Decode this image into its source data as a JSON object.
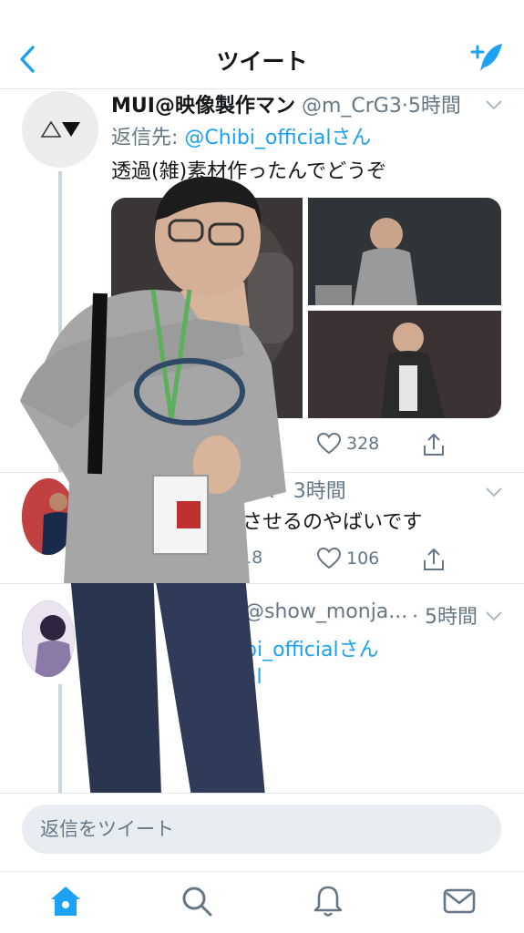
{
  "header": {
    "title": "ツイート"
  },
  "tweets": [
    {
      "name": "MUI@映像製作マン",
      "handle": "@m_CrG3",
      "time": "5時間",
      "reply_prefix": "返信先: ",
      "reply_to": "@Chibi_officialさん",
      "text": "透過(雑)素材作ったんでどうぞ",
      "likes": "328"
    },
    {
      "partial_meta": "k · 3時間",
      "partial_text": "させるのやばいです",
      "replies": "18",
      "likes": "106"
    },
    {
      "partial_meta": "@show_monja...",
      "time": "· 5時間",
      "partial_reply": "bi_officialさん",
      "partial_line": "hi",
      "partial_line_tail": "al"
    }
  ],
  "reply_bar": {
    "placeholder": "返信をツイート"
  },
  "tabs": [
    "home-icon",
    "search-icon",
    "notifications-icon",
    "messages-icon"
  ],
  "colors": {
    "accent": "#1da1f2",
    "secondary_text": "#657786",
    "divider": "#e1e8ed"
  }
}
